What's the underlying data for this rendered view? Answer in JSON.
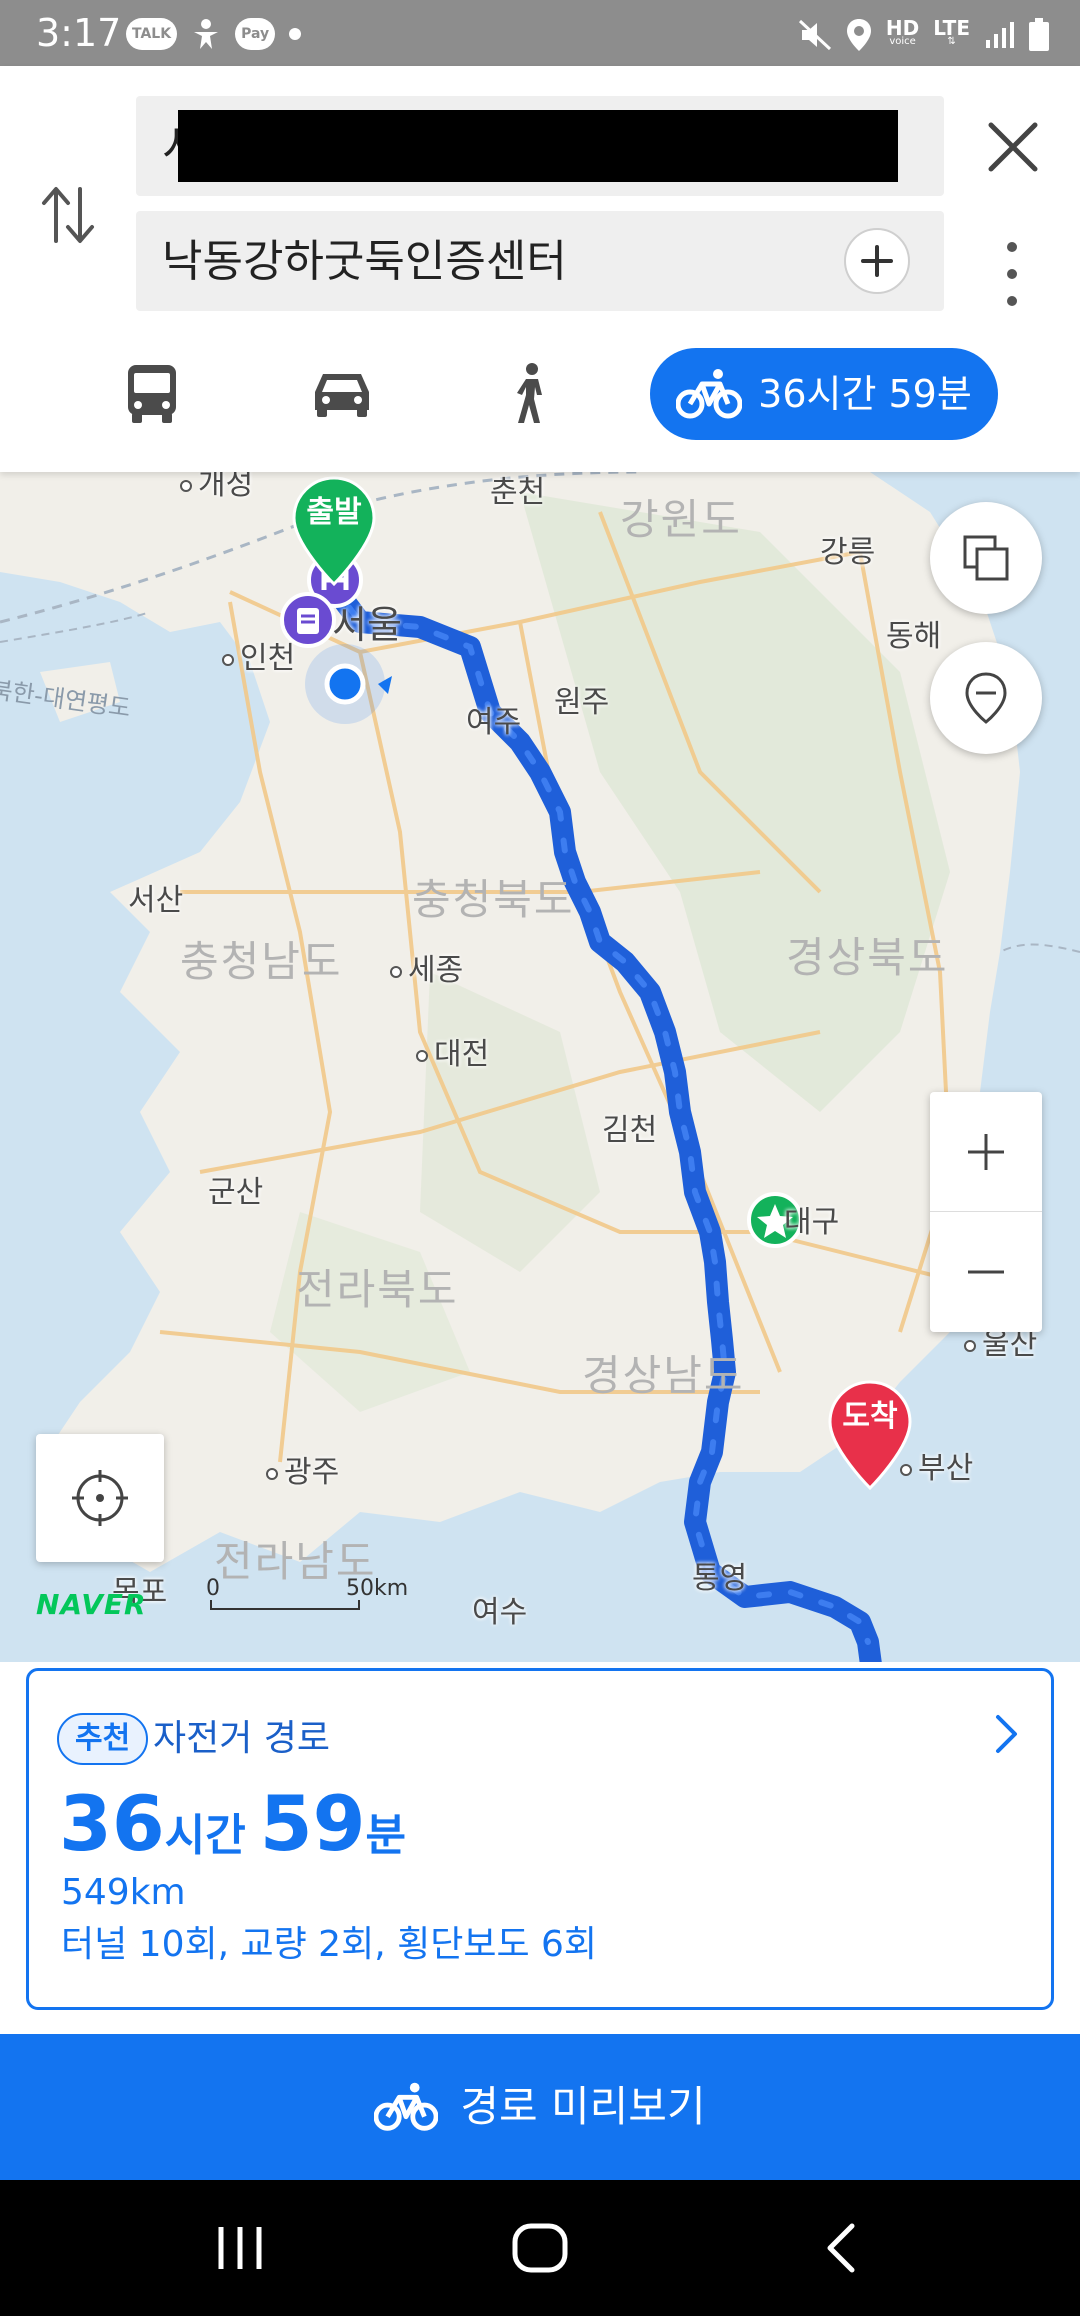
{
  "status_bar": {
    "time": "3:17",
    "left_icons": [
      "TALK",
      "Pay"
    ],
    "network": "HD",
    "network_sub": "voice",
    "lte": "LTE"
  },
  "search": {
    "start_value": "시",
    "goal_value": "낙동강하굿둑인증센터"
  },
  "modes": {
    "bus_icon": "bus-icon",
    "car_icon": "car-icon",
    "walk_icon": "walk-icon",
    "bike_label": "36시간 59분"
  },
  "map": {
    "start_pin": "출발",
    "goal_pin": "도착",
    "cities": {
      "gaeseong": "개성",
      "chuncheon": "춘천",
      "seoul": "서울",
      "incheon": "인천",
      "wonju": "원주",
      "yeoju": "여주",
      "gangneung": "강릉",
      "donghae": "동해",
      "seosan": "서산",
      "sejong": "세종",
      "daejeon": "대전",
      "gimcheon": "김천",
      "gunsan": "군산",
      "daegu": "대구",
      "ulsan": "울산",
      "busan": "부산",
      "gwangju": "광주",
      "mokpo": "목포",
      "yeosu": "여수",
      "tongyeong": "통영"
    },
    "regions": {
      "gangwon": "강원도",
      "chungbuk": "충청북도",
      "chungnam": "충청남도",
      "gyeongbuk": "경상북도",
      "jeonbuk": "전라북도",
      "gyeongnam": "경상남도",
      "jeonnam": "전라남도"
    },
    "sea_label": "북한-대연평도",
    "scale_start": "0",
    "scale_end": "50km",
    "logo": "NAVER"
  },
  "route_card": {
    "badge": "추천",
    "title": "자전거 경로",
    "hours": "36",
    "hours_unit": "시간",
    "minutes": "59",
    "minutes_unit": "분",
    "distance": "549km",
    "details": "터널 10회, 교량 2회, 횡단보도 6회"
  },
  "preview_button": {
    "label": "경로 미리보기"
  },
  "colors": {
    "accent": "#1374f0",
    "start_pin": "#13b25b",
    "goal_pin": "#e8304a",
    "route": "#1a56d6",
    "naver": "#03c75a"
  }
}
